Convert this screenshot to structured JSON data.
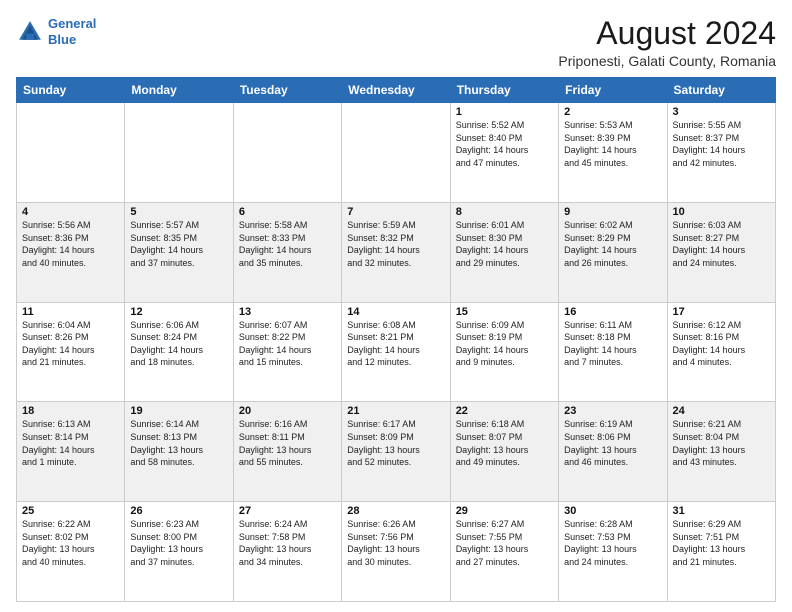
{
  "logo": {
    "line1": "General",
    "line2": "Blue"
  },
  "title": "August 2024",
  "subtitle": "Priponesti, Galati County, Romania",
  "weekdays": [
    "Sunday",
    "Monday",
    "Tuesday",
    "Wednesday",
    "Thursday",
    "Friday",
    "Saturday"
  ],
  "weeks": [
    [
      {
        "num": "",
        "info": ""
      },
      {
        "num": "",
        "info": ""
      },
      {
        "num": "",
        "info": ""
      },
      {
        "num": "",
        "info": ""
      },
      {
        "num": "1",
        "info": "Sunrise: 5:52 AM\nSunset: 8:40 PM\nDaylight: 14 hours\nand 47 minutes."
      },
      {
        "num": "2",
        "info": "Sunrise: 5:53 AM\nSunset: 8:39 PM\nDaylight: 14 hours\nand 45 minutes."
      },
      {
        "num": "3",
        "info": "Sunrise: 5:55 AM\nSunset: 8:37 PM\nDaylight: 14 hours\nand 42 minutes."
      }
    ],
    [
      {
        "num": "4",
        "info": "Sunrise: 5:56 AM\nSunset: 8:36 PM\nDaylight: 14 hours\nand 40 minutes."
      },
      {
        "num": "5",
        "info": "Sunrise: 5:57 AM\nSunset: 8:35 PM\nDaylight: 14 hours\nand 37 minutes."
      },
      {
        "num": "6",
        "info": "Sunrise: 5:58 AM\nSunset: 8:33 PM\nDaylight: 14 hours\nand 35 minutes."
      },
      {
        "num": "7",
        "info": "Sunrise: 5:59 AM\nSunset: 8:32 PM\nDaylight: 14 hours\nand 32 minutes."
      },
      {
        "num": "8",
        "info": "Sunrise: 6:01 AM\nSunset: 8:30 PM\nDaylight: 14 hours\nand 29 minutes."
      },
      {
        "num": "9",
        "info": "Sunrise: 6:02 AM\nSunset: 8:29 PM\nDaylight: 14 hours\nand 26 minutes."
      },
      {
        "num": "10",
        "info": "Sunrise: 6:03 AM\nSunset: 8:27 PM\nDaylight: 14 hours\nand 24 minutes."
      }
    ],
    [
      {
        "num": "11",
        "info": "Sunrise: 6:04 AM\nSunset: 8:26 PM\nDaylight: 14 hours\nand 21 minutes."
      },
      {
        "num": "12",
        "info": "Sunrise: 6:06 AM\nSunset: 8:24 PM\nDaylight: 14 hours\nand 18 minutes."
      },
      {
        "num": "13",
        "info": "Sunrise: 6:07 AM\nSunset: 8:22 PM\nDaylight: 14 hours\nand 15 minutes."
      },
      {
        "num": "14",
        "info": "Sunrise: 6:08 AM\nSunset: 8:21 PM\nDaylight: 14 hours\nand 12 minutes."
      },
      {
        "num": "15",
        "info": "Sunrise: 6:09 AM\nSunset: 8:19 PM\nDaylight: 14 hours\nand 9 minutes."
      },
      {
        "num": "16",
        "info": "Sunrise: 6:11 AM\nSunset: 8:18 PM\nDaylight: 14 hours\nand 7 minutes."
      },
      {
        "num": "17",
        "info": "Sunrise: 6:12 AM\nSunset: 8:16 PM\nDaylight: 14 hours\nand 4 minutes."
      }
    ],
    [
      {
        "num": "18",
        "info": "Sunrise: 6:13 AM\nSunset: 8:14 PM\nDaylight: 14 hours\nand 1 minute."
      },
      {
        "num": "19",
        "info": "Sunrise: 6:14 AM\nSunset: 8:13 PM\nDaylight: 13 hours\nand 58 minutes."
      },
      {
        "num": "20",
        "info": "Sunrise: 6:16 AM\nSunset: 8:11 PM\nDaylight: 13 hours\nand 55 minutes."
      },
      {
        "num": "21",
        "info": "Sunrise: 6:17 AM\nSunset: 8:09 PM\nDaylight: 13 hours\nand 52 minutes."
      },
      {
        "num": "22",
        "info": "Sunrise: 6:18 AM\nSunset: 8:07 PM\nDaylight: 13 hours\nand 49 minutes."
      },
      {
        "num": "23",
        "info": "Sunrise: 6:19 AM\nSunset: 8:06 PM\nDaylight: 13 hours\nand 46 minutes."
      },
      {
        "num": "24",
        "info": "Sunrise: 6:21 AM\nSunset: 8:04 PM\nDaylight: 13 hours\nand 43 minutes."
      }
    ],
    [
      {
        "num": "25",
        "info": "Sunrise: 6:22 AM\nSunset: 8:02 PM\nDaylight: 13 hours\nand 40 minutes."
      },
      {
        "num": "26",
        "info": "Sunrise: 6:23 AM\nSunset: 8:00 PM\nDaylight: 13 hours\nand 37 minutes."
      },
      {
        "num": "27",
        "info": "Sunrise: 6:24 AM\nSunset: 7:58 PM\nDaylight: 13 hours\nand 34 minutes."
      },
      {
        "num": "28",
        "info": "Sunrise: 6:26 AM\nSunset: 7:56 PM\nDaylight: 13 hours\nand 30 minutes."
      },
      {
        "num": "29",
        "info": "Sunrise: 6:27 AM\nSunset: 7:55 PM\nDaylight: 13 hours\nand 27 minutes."
      },
      {
        "num": "30",
        "info": "Sunrise: 6:28 AM\nSunset: 7:53 PM\nDaylight: 13 hours\nand 24 minutes."
      },
      {
        "num": "31",
        "info": "Sunrise: 6:29 AM\nSunset: 7:51 PM\nDaylight: 13 hours\nand 21 minutes."
      }
    ]
  ]
}
